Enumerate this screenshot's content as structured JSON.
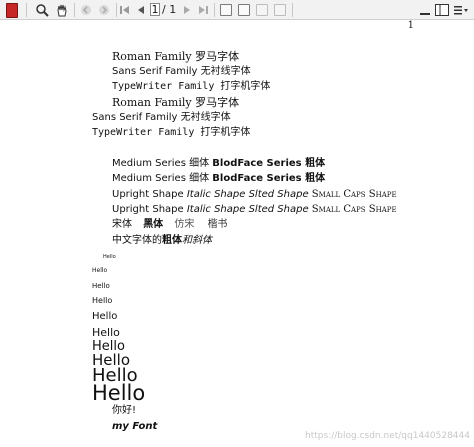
{
  "toolbar": {
    "page_current": "1",
    "page_total": "/ 1"
  },
  "page": {
    "page_number": "1",
    "lines": {
      "l1": "Roman Family 罗马字体",
      "l2": "Sans Serif Family 无衬线字体",
      "l3": "TypeWriter Family 打字机字体",
      "l4": "Roman Family 罗马字体",
      "l5": "Sans Serif Family 无衬线字体",
      "l6": "TypeWriter Family 打字机字体"
    },
    "series1": {
      "a": "Medium Series 细体 ",
      "b": "BlodFace Series 粗体"
    },
    "series2": {
      "a": "Medium Series 细体 ",
      "b": "BlodFace Series 粗体"
    },
    "shape1": {
      "a": "Upright Shape ",
      "b": "Italic Shape Slted Shape ",
      "c": "Small Caps Shape"
    },
    "shape2": {
      "a": "Upright Shape ",
      "b": "Italic Shape Slted Shape ",
      "c": "Small Caps Shape"
    },
    "cjk": {
      "a": "宋体",
      "b": "黑体",
      "c": "仿宋",
      "d": "楷书"
    },
    "mixed": {
      "a": "中文字体的",
      "b": "粗体",
      "c": "和斜体"
    },
    "hello": "Hello",
    "nihao": "你好!",
    "myfont": "my Font",
    "watermark": "https://blog.csdn.net/qq1440528444"
  }
}
